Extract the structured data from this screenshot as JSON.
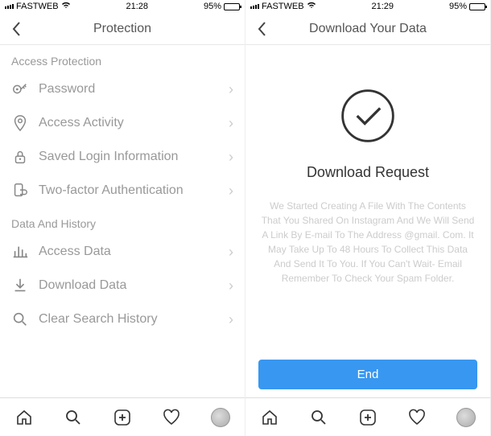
{
  "left": {
    "status": {
      "carrier": "FASTWEB",
      "time": "21:28",
      "battery": "95%"
    },
    "nav": {
      "title": "Protection"
    },
    "sections": [
      {
        "header": "Access Protection",
        "items": [
          {
            "icon": "key-icon",
            "label": "Password"
          },
          {
            "icon": "location-icon",
            "label": "Access Activity"
          },
          {
            "icon": "lock-icon",
            "label": "Saved Login Information"
          },
          {
            "icon": "shield-icon",
            "label": "Two-factor Authentication"
          }
        ]
      },
      {
        "header": "Data And History",
        "items": [
          {
            "icon": "chart-icon",
            "label": "Access Data"
          },
          {
            "icon": "download-icon",
            "label": "Download Data"
          },
          {
            "icon": "search-icon",
            "label": "Clear Search History"
          }
        ]
      }
    ]
  },
  "right": {
    "status": {
      "carrier": "FASTWEB",
      "time": "21:29",
      "battery": "95%"
    },
    "nav": {
      "title": "Download Your Data"
    },
    "heading": "Download Request",
    "desc_line1": "We Started Creating A File With The Contents That You Shared On Instagram And We Will Send A Link By E-mail To The Address",
    "desc_email": "@gmail. Com.",
    "desc_line2": "It May Take Up To 48 Hours To Collect This Data And Send It To You. If You Can't Wait- Email Remember To Check Your Spam Folder.",
    "button": "End"
  }
}
